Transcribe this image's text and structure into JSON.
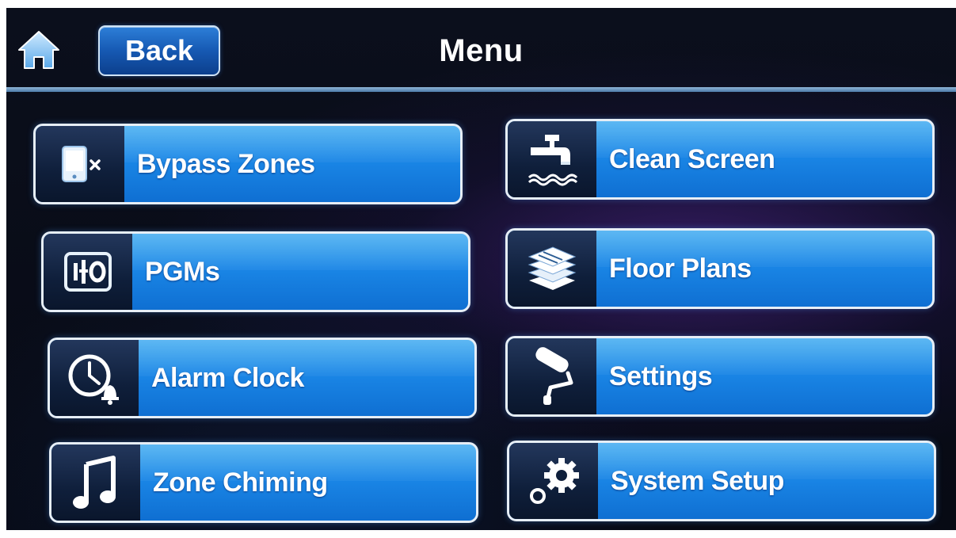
{
  "header": {
    "home_icon": "home-icon",
    "back_label": "Back",
    "title": "Menu"
  },
  "menu": {
    "items": [
      {
        "label": "Bypass Zones",
        "icon": "bypass-zones-icon"
      },
      {
        "label": "Clean Screen",
        "icon": "faucet-icon"
      },
      {
        "label": "PGMs",
        "icon": "pgm-switch-icon"
      },
      {
        "label": "Floor Plans",
        "icon": "layers-icon"
      },
      {
        "label": "Alarm Clock",
        "icon": "alarm-clock-icon"
      },
      {
        "label": "Settings",
        "icon": "paint-roller-icon"
      },
      {
        "label": "Zone Chiming",
        "icon": "music-note-icon"
      },
      {
        "label": "System Setup",
        "icon": "gears-icon"
      }
    ]
  },
  "colors": {
    "button_blue": "#1a86e6",
    "icon_panel": "#0f1f3b",
    "background": "#070a14",
    "border": "#e6eef6"
  }
}
